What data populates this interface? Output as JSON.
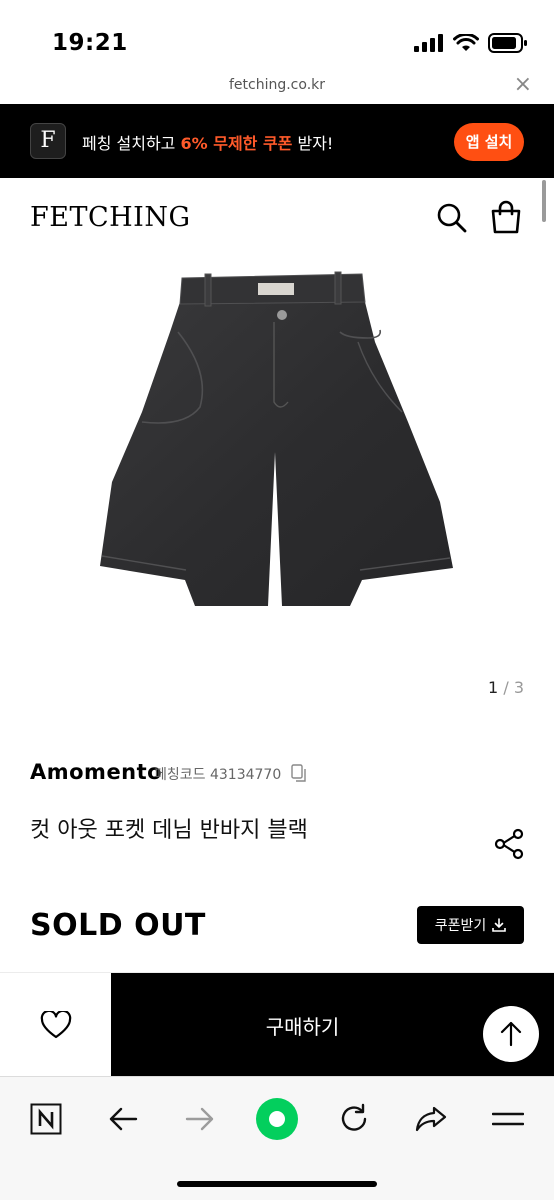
{
  "status_bar": {
    "time": "19:21"
  },
  "url_bar": {
    "url": "fetching.co.kr",
    "close_symbol": "×"
  },
  "app_banner": {
    "logo_letter": "F",
    "text_prefix": "페칭 설치하고 ",
    "text_highlight": "6% 무제한 쿠폰",
    "text_suffix": " 받자!",
    "install_button": "앱 설치",
    "accent_color": "#ff4f12"
  },
  "header": {
    "logo": "FETCHING",
    "search_icon": "search-icon",
    "bag_icon": "shopping-bag-icon"
  },
  "gallery": {
    "current": "1",
    "separator": "/",
    "total": "3"
  },
  "product": {
    "brand": "Amomento",
    "code_label": "페칭코드 43134770",
    "name": "컷 아웃 포켓 데님 반바지 블랙",
    "price_status": "SOLD OUT",
    "coupon_button": "쿠폰받기"
  },
  "bottom_bar": {
    "buy_button": "구매하기"
  }
}
